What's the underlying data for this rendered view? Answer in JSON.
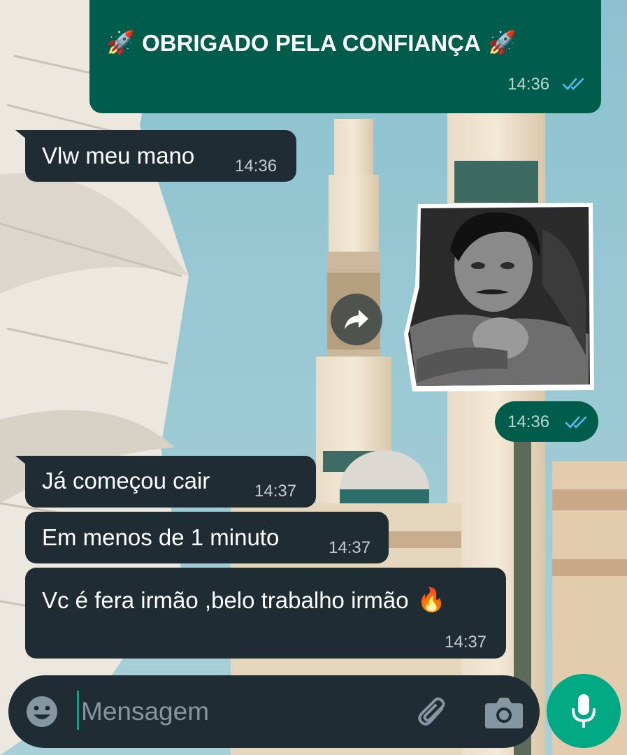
{
  "messages": [
    {
      "id": "thanks",
      "direction": "outgoing",
      "text": "OBRIGADO PELA CONFIANÇA",
      "prefix_emoji": "🚀",
      "suffix_emoji": "🚀",
      "time": "14:36",
      "status": "read"
    },
    {
      "id": "vlw",
      "direction": "incoming",
      "text": "Vlw meu mano",
      "time": "14:36"
    },
    {
      "id": "sticker",
      "direction": "outgoing",
      "type": "sticker",
      "time": "14:36",
      "status": "read"
    },
    {
      "id": "comecou",
      "direction": "incoming",
      "text": "Já começou cair",
      "time": "14:37"
    },
    {
      "id": "menos",
      "direction": "incoming",
      "text": "Em menos de 1 minuto",
      "time": "14:37"
    },
    {
      "id": "fera",
      "direction": "incoming",
      "text": "Vc é fera irmão ,belo trabalho irmão",
      "suffix_emoji": "🔥",
      "time": "14:37"
    }
  ],
  "composer": {
    "placeholder": "Mensagem",
    "icons": [
      "emoji-icon",
      "attach-icon",
      "camera-icon",
      "mic-icon"
    ]
  },
  "forward_icon": "forward-icon",
  "colors": {
    "incoming_bubble": "#1f2c34",
    "outgoing_bubble": "#005c4b",
    "accent": "#00a884",
    "read_ticks": "#53bdeb",
    "time_text": "#c3ccd2"
  }
}
